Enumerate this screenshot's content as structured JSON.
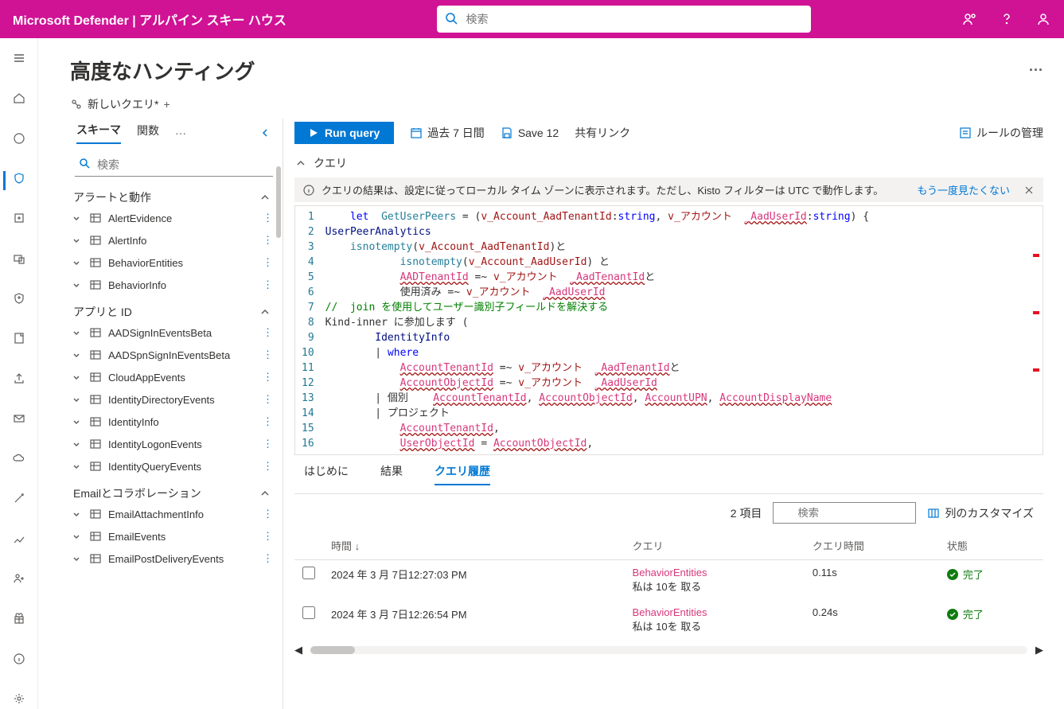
{
  "header": {
    "brand": "Microsoft Defender | アルパイン スキー ハウス",
    "search_placeholder": "検索"
  },
  "page": {
    "title": "高度なハンティング"
  },
  "query_tabs": {
    "new_query": "新しいクエリ*",
    "add": "+"
  },
  "schema_panel": {
    "tab_schema": "スキーマ",
    "tab_functions": "関数",
    "search_placeholder": "検索",
    "groups": [
      {
        "label": "アラートと動作",
        "tables": [
          "AlertEvidence",
          "AlertInfo",
          "BehaviorEntities",
          "BehaviorInfo"
        ]
      },
      {
        "label": "アプリと ID",
        "tables": [
          "AADSignInEventsBeta",
          "AADSpnSignInEventsBeta",
          "CloudAppEvents",
          "IdentityDirectoryEvents",
          "IdentityInfo",
          "IdentityLogonEvents",
          "IdentityQueryEvents"
        ]
      },
      {
        "label": "Emailとコラボレーション",
        "tables": [
          "EmailAttachmentInfo",
          "EmailEvents",
          "EmailPostDeliveryEvents"
        ]
      }
    ]
  },
  "toolbar": {
    "run": "Run query",
    "time_range": "過去 7 日間",
    "save": "Save 12",
    "link": "共有リンク",
    "manage_rules": "ルールの管理"
  },
  "query_section": {
    "label": "クエリ",
    "info_text": "クエリの結果は、設定に従ってローカル タイム ゾーンに表示されます。ただし、Kisto フィルターは UTC で動作します。",
    "info_link": "もう一度見たくない"
  },
  "results": {
    "tab_start": "はじめに",
    "tab_results": "結果",
    "tab_history": "クエリ履歴",
    "item_count": "2 項目",
    "search_placeholder": "検索",
    "customize": "列のカスタマイズ",
    "columns": {
      "time": "時間",
      "query": "クエリ",
      "duration": "クエリ時間",
      "status": "状態"
    },
    "rows": [
      {
        "time_date": "2024 年 3 月 7日",
        "time_clock": "12:27:03 PM",
        "query_main": "BehaviorEntities",
        "query_sub": "私は 10を 取る",
        "duration": "0.11s",
        "status": "完了"
      },
      {
        "time_date": "2024 年 3 月 7日",
        "time_clock": "12:26:54 PM",
        "query_main": "BehaviorEntities",
        "query_sub": "私は 10を 取る",
        "duration": "0.24s",
        "status": "完了"
      }
    ]
  },
  "code": {
    "lines": [
      "    let  GetUserPeers = (v_Account_AadTenantId:string, v_アカウント  _AadUserId:string) {",
      "UserPeerAnalytics",
      "    isnotempty(v_Account_AadTenantId)と",
      "            isnotempty(v_Account_AadUserId) と",
      "            AADTenantId =~ v_アカウント  _AadTenantIdと",
      "            使用済み =~ v_アカウント  _AadUserId",
      "//  join を使用してユーザー識別子フィールドを解決する",
      "Kind-inner に参加します (",
      "        IdentityInfo",
      "        | where",
      "            AccountTenantId =~ v_アカウント  _AadTenantIdと",
      "            AccountObjectId =~ v_アカウント  _AadUserId",
      "        | 個別    AccountTenantId, AccountObjectId, AccountUPN, AccountDisplayName",
      "        | プロジェクト",
      "            AccountTenantId,",
      "            UserObjectId = AccountObjectId,"
    ]
  }
}
